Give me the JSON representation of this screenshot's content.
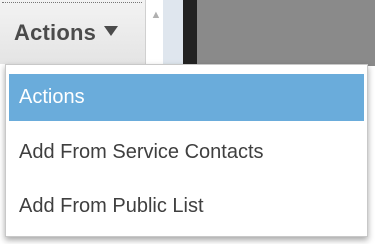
{
  "trigger": {
    "label": "Actions"
  },
  "menu": {
    "items": [
      {
        "label": "Actions",
        "selected": true
      },
      {
        "label": "Add From Service Contacts",
        "selected": false
      },
      {
        "label": "Add From Public List",
        "selected": false
      }
    ]
  },
  "colors": {
    "highlight": "#6aacdb",
    "text": "#3f3f3f"
  },
  "icons": {
    "caret": "caret-down-icon",
    "scroll_up": "scroll-up-icon"
  }
}
